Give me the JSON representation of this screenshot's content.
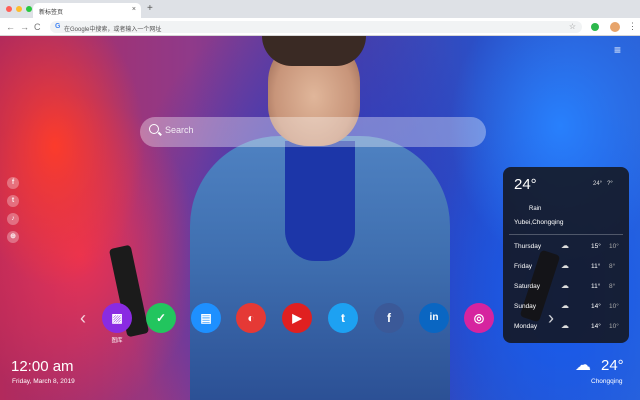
{
  "browser": {
    "tab_title": "新标签页",
    "tab_close": "×",
    "tab_new": "+",
    "back": "←",
    "forward": "→",
    "reload": "C",
    "google_icon": "G",
    "omnibox_placeholder": "在Google中搜索，或者输入一个网址",
    "star": "☆",
    "menu": "⋮"
  },
  "page": {
    "menu_icon": "≡",
    "search_placeholder": "Search"
  },
  "social": [
    {
      "glyph": "f",
      "icon": "facebook-icon"
    },
    {
      "glyph": "t",
      "icon": "twitter-icon"
    },
    {
      "glyph": "♪",
      "icon": "music-icon"
    },
    {
      "glyph": "⊕",
      "icon": "browser-icon"
    }
  ],
  "weather_panel": {
    "temp": "24°",
    "high": "24°",
    "low": "?°",
    "condition": "Rain",
    "location": "Yubei,Chongqing",
    "forecast": [
      {
        "day": "Thursday",
        "icon": "☁",
        "high": "15°",
        "low": "10°"
      },
      {
        "day": "Friday",
        "icon": "☁",
        "high": "11°",
        "low": "8°"
      },
      {
        "day": "Saturday",
        "icon": "☁",
        "high": "11°",
        "low": "8°"
      },
      {
        "day": "Sunday",
        "icon": "☁",
        "high": "14°",
        "low": "10°"
      },
      {
        "day": "Monday",
        "icon": "☁",
        "high": "14°",
        "low": "10°"
      }
    ]
  },
  "apps": [
    {
      "name": "gallery",
      "label": "图库",
      "glyph": "▨",
      "color": "#8a2be2"
    },
    {
      "name": "check",
      "label": "",
      "glyph": "✓",
      "color": "#22c55e"
    },
    {
      "name": "notes",
      "label": "",
      "glyph": "▤",
      "color": "#1e90ff"
    },
    {
      "name": "game",
      "label": "",
      "glyph": "◐",
      "color": "#e53935"
    },
    {
      "name": "youtube",
      "label": "",
      "glyph": "▶",
      "color": "#e02020"
    },
    {
      "name": "twitter",
      "label": "",
      "glyph": "t",
      "color": "#1da1f2"
    },
    {
      "name": "facebook",
      "label": "",
      "glyph": "f",
      "color": "#3b5998"
    },
    {
      "name": "linkedin",
      "label": "",
      "glyph": "in",
      "color": "#0a66c2"
    },
    {
      "name": "instagram",
      "label": "",
      "glyph": "◎",
      "color": "#d6249f"
    }
  ],
  "nav": {
    "prev": "‹",
    "next": "›"
  },
  "clock": {
    "time": "12:00 am",
    "date": "Friday, March 8, 2019"
  },
  "current_weather": {
    "icon": "☁",
    "temp": "24°",
    "city": "Chongqing"
  },
  "colors": {
    "dot_red": "#ff5f57",
    "dot_yellow": "#febc2e",
    "dot_green": "#28c840"
  }
}
